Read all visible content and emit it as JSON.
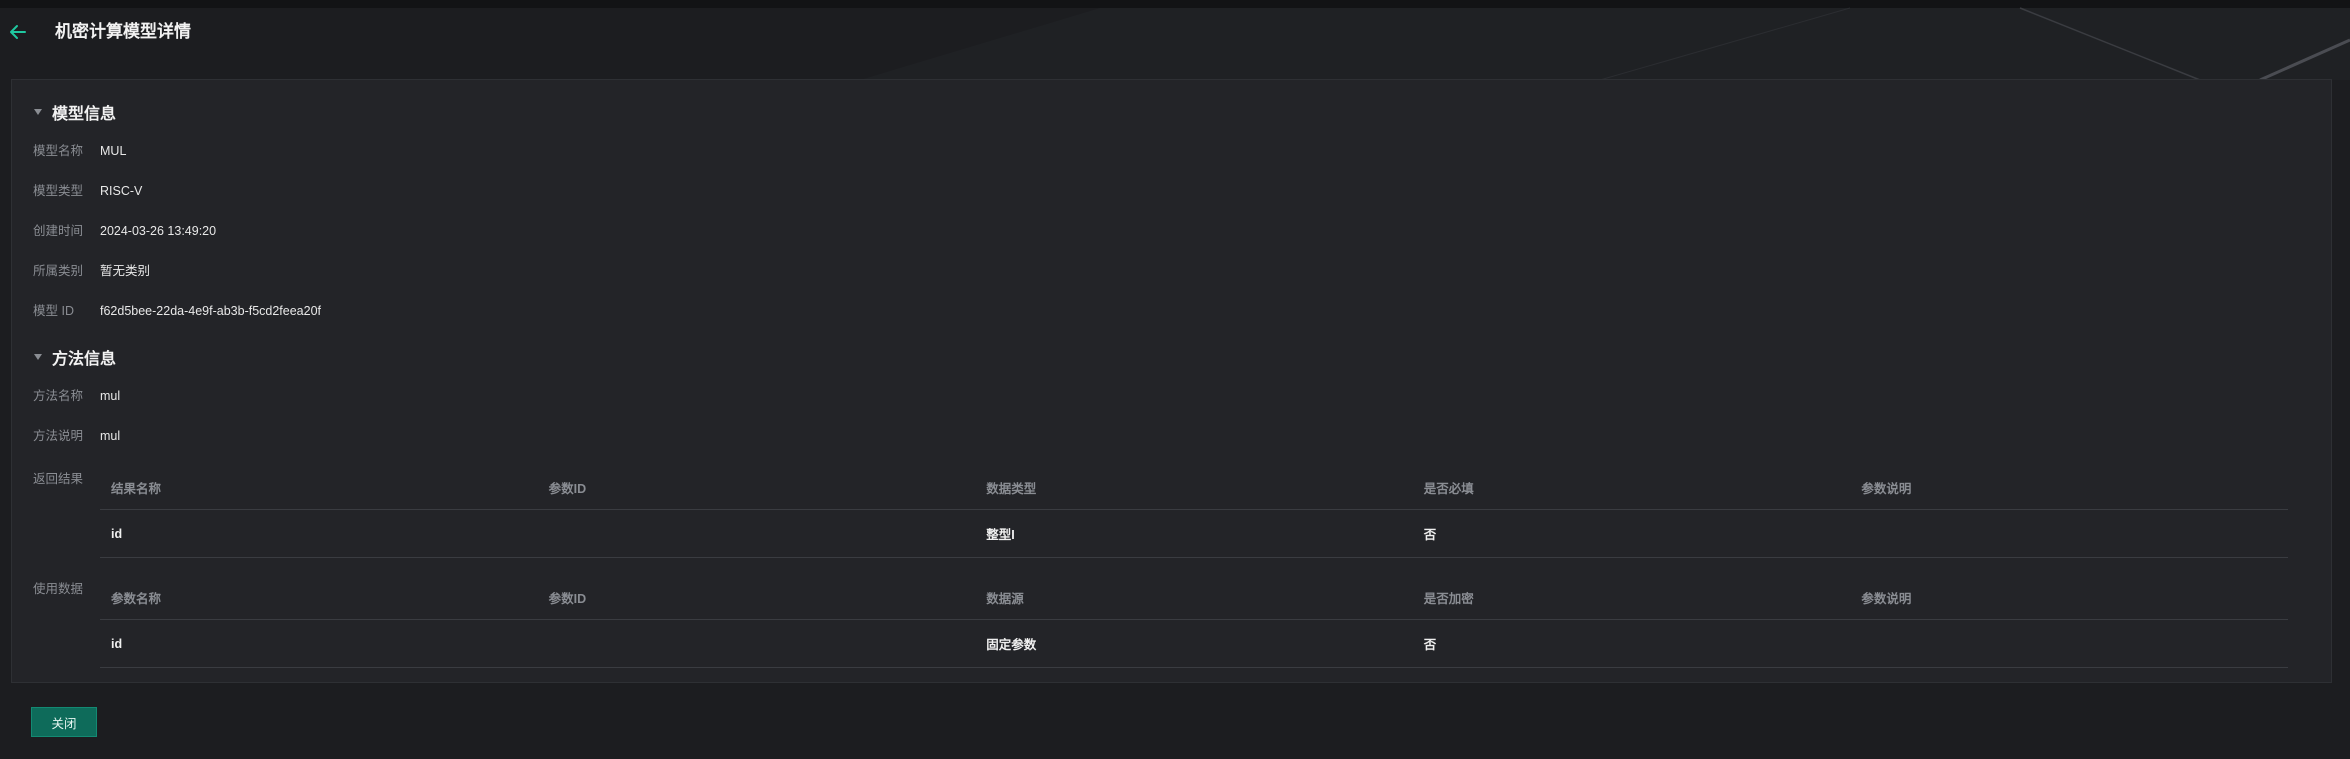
{
  "header": {
    "title": "机密计算模型详情"
  },
  "model_section": {
    "title": "模型信息",
    "fields": [
      {
        "label": "模型名称",
        "value": "MUL"
      },
      {
        "label": "模型类型",
        "value": "RISC-V"
      },
      {
        "label": "创建时间",
        "value": "2024-03-26 13:49:20"
      },
      {
        "label": "所属类别",
        "value": "暂无类别"
      },
      {
        "label": "模型 ID",
        "value": "f62d5bee-22da-4e9f-ab3b-f5cd2feea20f"
      }
    ]
  },
  "method_section": {
    "title": "方法信息",
    "fields": [
      {
        "label": "方法名称",
        "value": "mul"
      },
      {
        "label": "方法说明",
        "value": "mul"
      }
    ],
    "return_result": {
      "label": "返回结果",
      "columns": [
        "结果名称",
        "参数ID",
        "数据类型",
        "是否必填",
        "参数说明"
      ],
      "rows": [
        [
          "id",
          "",
          "整型I",
          "否",
          ""
        ]
      ]
    },
    "use_data": {
      "label": "使用数据",
      "columns": [
        "参数名称",
        "参数ID",
        "数据源",
        "是否加密",
        "参数说明"
      ],
      "rows": [
        [
          "id",
          "",
          "固定参数",
          "否",
          ""
        ]
      ]
    }
  },
  "footer": {
    "close_label": "关闭"
  },
  "colors": {
    "accent": "#1fc8a0",
    "button_bg": "#0e6b5a",
    "background": "#1c1d20",
    "panel": "#232428"
  }
}
